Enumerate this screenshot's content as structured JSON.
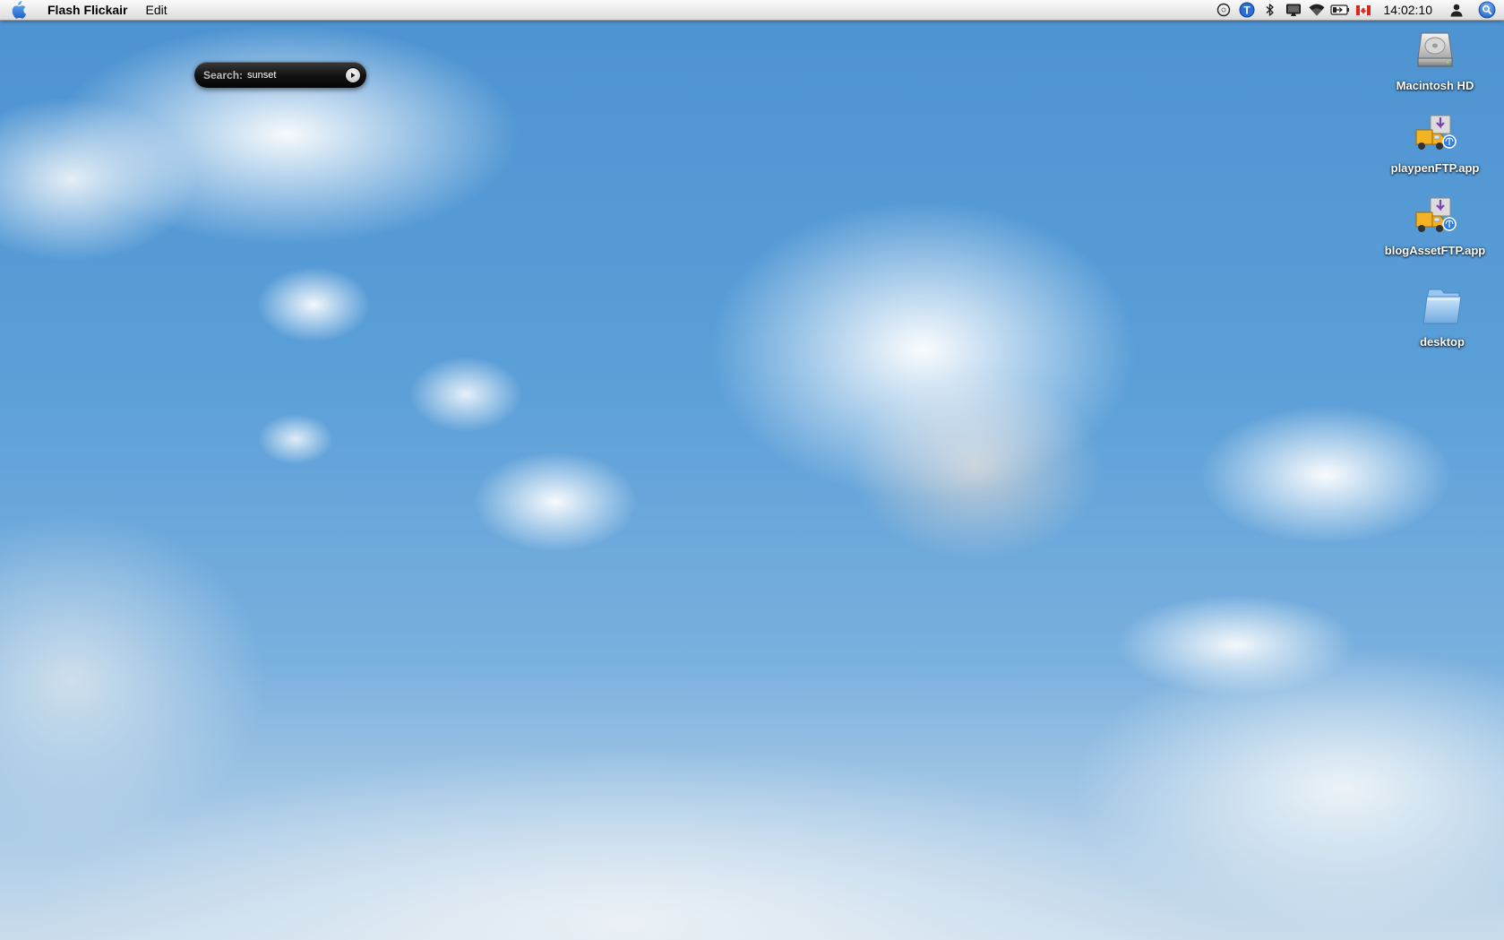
{
  "menubar": {
    "app_name": "Flash Flickair",
    "menus": [
      "Edit"
    ],
    "clock": "14:02:10",
    "status_icons": [
      "sync-icon",
      "typinator-icon",
      "bluetooth-icon",
      "display-icon",
      "wifi-icon",
      "battery-icon",
      "canada-flag-icon",
      "user-icon",
      "spotlight-icon"
    ]
  },
  "search_widget": {
    "label": "Search:",
    "value": "sunset"
  },
  "desktop_icons": [
    {
      "label": "Macintosh HD",
      "icon": "hard-drive-icon"
    },
    {
      "label": "playpenFTP.app",
      "icon": "ftp-truck-icon"
    },
    {
      "label": "blogAssetFTP.app",
      "icon": "ftp-truck-icon"
    },
    {
      "label": "desktop",
      "icon": "folder-icon"
    }
  ],
  "colors": {
    "sky": "#5b9fd8",
    "menubar": "#ececec",
    "widget": "#111111",
    "spotlight": "#2a74e0"
  }
}
